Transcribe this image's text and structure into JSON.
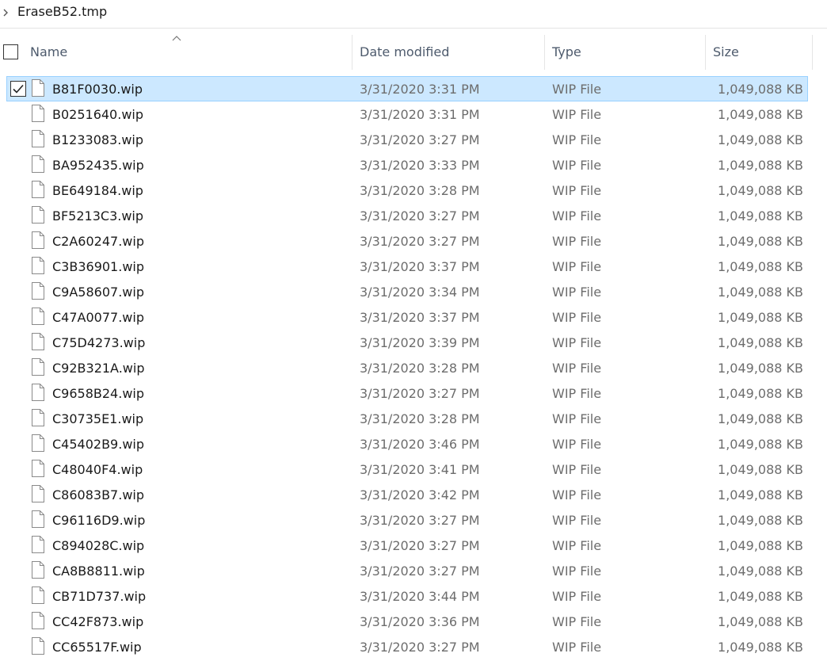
{
  "breadcrumb": {
    "folder": "EraseB52.tmp"
  },
  "columns": {
    "name": "Name",
    "date": "Date modified",
    "type": "Type",
    "size": "Size"
  },
  "selected_index": 0,
  "files": [
    {
      "name": "B81F0030.wip",
      "date": "3/31/2020 3:31 PM",
      "type": "WIP File",
      "size": "1,049,088 KB"
    },
    {
      "name": "B0251640.wip",
      "date": "3/31/2020 3:31 PM",
      "type": "WIP File",
      "size": "1,049,088 KB"
    },
    {
      "name": "B1233083.wip",
      "date": "3/31/2020 3:27 PM",
      "type": "WIP File",
      "size": "1,049,088 KB"
    },
    {
      "name": "BA952435.wip",
      "date": "3/31/2020 3:33 PM",
      "type": "WIP File",
      "size": "1,049,088 KB"
    },
    {
      "name": "BE649184.wip",
      "date": "3/31/2020 3:28 PM",
      "type": "WIP File",
      "size": "1,049,088 KB"
    },
    {
      "name": "BF5213C3.wip",
      "date": "3/31/2020 3:27 PM",
      "type": "WIP File",
      "size": "1,049,088 KB"
    },
    {
      "name": "C2A60247.wip",
      "date": "3/31/2020 3:27 PM",
      "type": "WIP File",
      "size": "1,049,088 KB"
    },
    {
      "name": "C3B36901.wip",
      "date": "3/31/2020 3:37 PM",
      "type": "WIP File",
      "size": "1,049,088 KB"
    },
    {
      "name": "C9A58607.wip",
      "date": "3/31/2020 3:34 PM",
      "type": "WIP File",
      "size": "1,049,088 KB"
    },
    {
      "name": "C47A0077.wip",
      "date": "3/31/2020 3:37 PM",
      "type": "WIP File",
      "size": "1,049,088 KB"
    },
    {
      "name": "C75D4273.wip",
      "date": "3/31/2020 3:39 PM",
      "type": "WIP File",
      "size": "1,049,088 KB"
    },
    {
      "name": "C92B321A.wip",
      "date": "3/31/2020 3:28 PM",
      "type": "WIP File",
      "size": "1,049,088 KB"
    },
    {
      "name": "C9658B24.wip",
      "date": "3/31/2020 3:27 PM",
      "type": "WIP File",
      "size": "1,049,088 KB"
    },
    {
      "name": "C30735E1.wip",
      "date": "3/31/2020 3:28 PM",
      "type": "WIP File",
      "size": "1,049,088 KB"
    },
    {
      "name": "C45402B9.wip",
      "date": "3/31/2020 3:46 PM",
      "type": "WIP File",
      "size": "1,049,088 KB"
    },
    {
      "name": "C48040F4.wip",
      "date": "3/31/2020 3:41 PM",
      "type": "WIP File",
      "size": "1,049,088 KB"
    },
    {
      "name": "C86083B7.wip",
      "date": "3/31/2020 3:42 PM",
      "type": "WIP File",
      "size": "1,049,088 KB"
    },
    {
      "name": "C96116D9.wip",
      "date": "3/31/2020 3:27 PM",
      "type": "WIP File",
      "size": "1,049,088 KB"
    },
    {
      "name": "C894028C.wip",
      "date": "3/31/2020 3:27 PM",
      "type": "WIP File",
      "size": "1,049,088 KB"
    },
    {
      "name": "CA8B8811.wip",
      "date": "3/31/2020 3:27 PM",
      "type": "WIP File",
      "size": "1,049,088 KB"
    },
    {
      "name": "CB71D737.wip",
      "date": "3/31/2020 3:44 PM",
      "type": "WIP File",
      "size": "1,049,088 KB"
    },
    {
      "name": "CC42F873.wip",
      "date": "3/31/2020 3:36 PM",
      "type": "WIP File",
      "size": "1,049,088 KB"
    },
    {
      "name": "CC65517F.wip",
      "date": "3/31/2020 3:27 PM",
      "type": "WIP File",
      "size": "1,049,088 KB"
    }
  ]
}
